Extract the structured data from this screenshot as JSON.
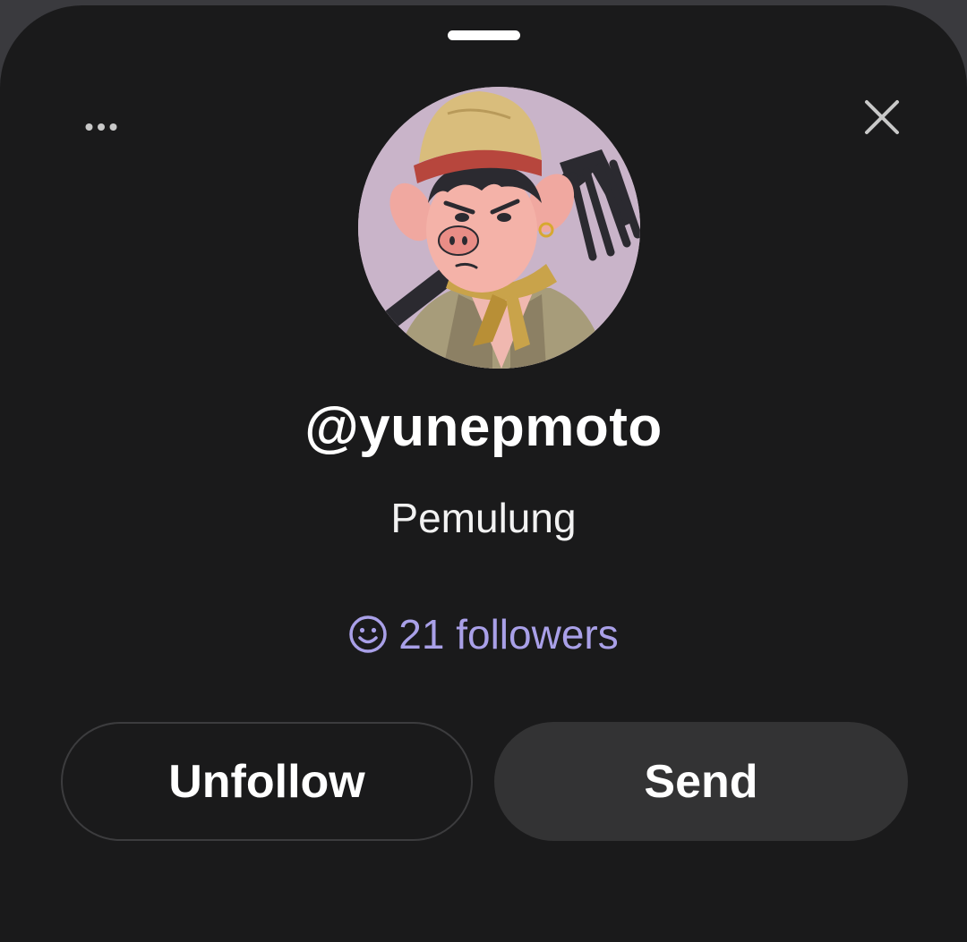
{
  "sheet": {
    "icons": {
      "more": "more-horizontal-icon",
      "close": "close-icon",
      "followers": "smiley-icon"
    }
  },
  "profile": {
    "username": "@yunepmoto",
    "bio": "Pemulung",
    "followers_text": "21 followers",
    "avatar_description": "cartoon pig character with headband holding a rake"
  },
  "actions": {
    "unfollow_label": "Unfollow",
    "send_label": "Send"
  },
  "colors": {
    "background": "#1a1a1b",
    "accent": "#a9a0e8",
    "send_button": "#333334",
    "text": "#ffffff"
  }
}
